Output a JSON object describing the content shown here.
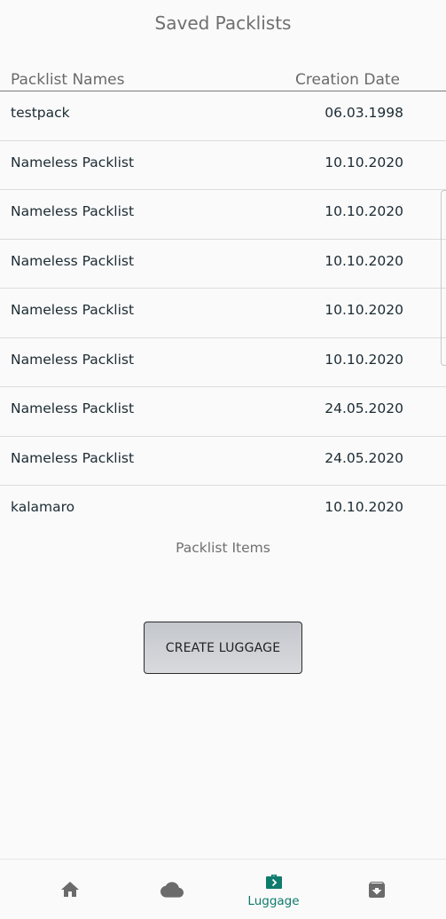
{
  "header": {
    "title": "Saved Packlists"
  },
  "table": {
    "columns": [
      "Packlist Names",
      "Creation Date"
    ],
    "rows": [
      {
        "name": "testpack",
        "date": "06.03.1998"
      },
      {
        "name": "Nameless Packlist",
        "date": "10.10.2020"
      },
      {
        "name": "Nameless Packlist",
        "date": "10.10.2020"
      },
      {
        "name": "Nameless Packlist",
        "date": "10.10.2020"
      },
      {
        "name": "Nameless Packlist",
        "date": "10.10.2020"
      },
      {
        "name": "Nameless Packlist",
        "date": "10.10.2020"
      },
      {
        "name": "Nameless Packlist",
        "date": "24.05.2020"
      },
      {
        "name": "Nameless Packlist",
        "date": "24.05.2020"
      },
      {
        "name": "kalamaro",
        "date": "10.10.2020"
      }
    ]
  },
  "items_section": {
    "label": "Packlist Items"
  },
  "actions": {
    "create_label": "CREATE LUGGAGE"
  },
  "navbar": {
    "items": [
      {
        "icon": "home-icon",
        "label": ""
      },
      {
        "icon": "cloud-icon",
        "label": ""
      },
      {
        "icon": "luggage-icon",
        "label": "Luggage",
        "active": true
      },
      {
        "icon": "archive-icon",
        "label": ""
      }
    ]
  },
  "colors": {
    "accent": "#0f7b6c",
    "inactive_icon": "#6b6b6b",
    "text": "#1c2b33",
    "background": "#fafafa"
  }
}
